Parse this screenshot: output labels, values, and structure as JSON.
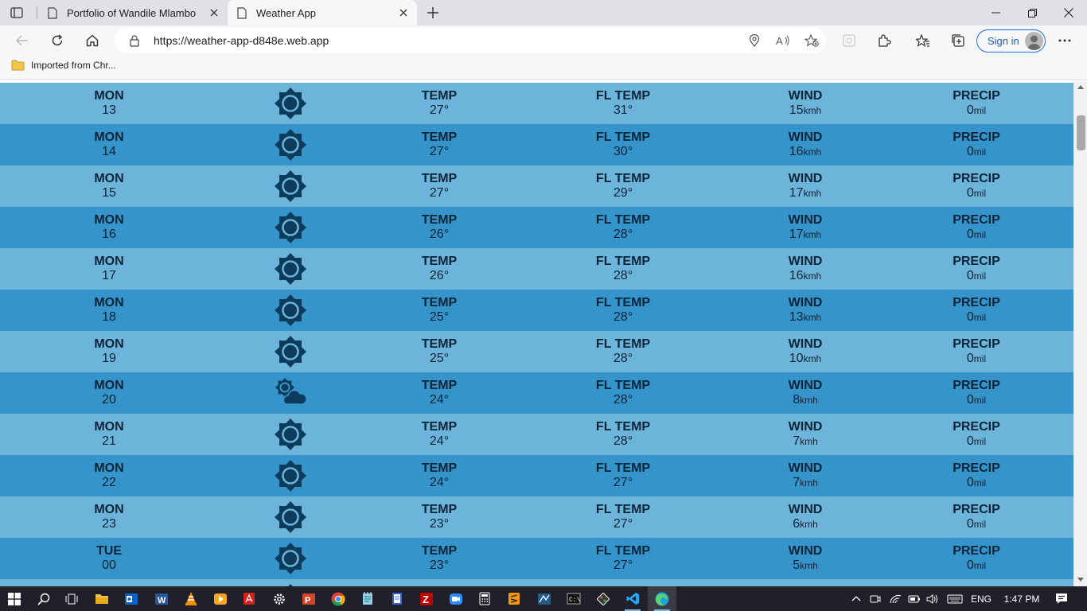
{
  "browser": {
    "tabs": [
      {
        "title": "Portfolio of Wandile Mlambo",
        "active": false
      },
      {
        "title": "Weather App",
        "active": true
      }
    ],
    "url": "https://weather-app-d848e.web.app",
    "signin_label": "Sign in",
    "bookmarks": [
      {
        "label": "Imported from Chr..."
      }
    ]
  },
  "forecast": {
    "labels": {
      "temp": "TEMP",
      "fl_temp": "FL TEMP",
      "wind": "WIND",
      "precip": "PRECIP",
      "wind_unit": "kmh",
      "precip_unit": "mil"
    },
    "rows": [
      {
        "day": "MON",
        "hour": "13",
        "icon": "sun-icon",
        "temp": "27°",
        "fl": "31°",
        "wind": "15",
        "precip": "0"
      },
      {
        "day": "MON",
        "hour": "14",
        "icon": "sun-icon",
        "temp": "27°",
        "fl": "30°",
        "wind": "16",
        "precip": "0"
      },
      {
        "day": "MON",
        "hour": "15",
        "icon": "sun-icon",
        "temp": "27°",
        "fl": "29°",
        "wind": "17",
        "precip": "0"
      },
      {
        "day": "MON",
        "hour": "16",
        "icon": "sun-icon",
        "temp": "26°",
        "fl": "28°",
        "wind": "17",
        "precip": "0"
      },
      {
        "day": "MON",
        "hour": "17",
        "icon": "sun-icon",
        "temp": "26°",
        "fl": "28°",
        "wind": "16",
        "precip": "0"
      },
      {
        "day": "MON",
        "hour": "18",
        "icon": "sun-icon",
        "temp": "25°",
        "fl": "28°",
        "wind": "13",
        "precip": "0"
      },
      {
        "day": "MON",
        "hour": "19",
        "icon": "sun-icon",
        "temp": "25°",
        "fl": "28°",
        "wind": "10",
        "precip": "0"
      },
      {
        "day": "MON",
        "hour": "20",
        "icon": "partly-cloudy-icon",
        "temp": "24°",
        "fl": "28°",
        "wind": "8",
        "precip": "0"
      },
      {
        "day": "MON",
        "hour": "21",
        "icon": "sun-icon",
        "temp": "24°",
        "fl": "28°",
        "wind": "7",
        "precip": "0"
      },
      {
        "day": "MON",
        "hour": "22",
        "icon": "sun-icon",
        "temp": "24°",
        "fl": "27°",
        "wind": "7",
        "precip": "0"
      },
      {
        "day": "MON",
        "hour": "23",
        "icon": "sun-icon",
        "temp": "23°",
        "fl": "27°",
        "wind": "6",
        "precip": "0"
      },
      {
        "day": "TUE",
        "hour": "00",
        "icon": "sun-icon",
        "temp": "23°",
        "fl": "27°",
        "wind": "5",
        "precip": "0"
      },
      {
        "day": "",
        "hour": "",
        "icon": "sun-icon",
        "temp": "",
        "fl": "",
        "wind": "",
        "precip": ""
      }
    ],
    "colors": {
      "row_light": "#6cb4d9",
      "row_dark": "#3595cb",
      "icon": "#0d3b5c",
      "text": "#0d2338"
    }
  },
  "taskbar": {
    "apps": [
      "start-icon",
      "search-icon",
      "task-view-icon",
      "file-explorer-icon",
      "outlook-icon",
      "word-icon",
      "vlc-icon",
      "media-player-icon",
      "acrobat-icon",
      "settings-icon",
      "powerpoint-icon",
      "chrome-icon",
      "notepad-icon",
      "notes-icon",
      "filezilla-icon",
      "zoom-icon",
      "calculator-icon",
      "sublime-icon",
      "network-tool-icon",
      "terminal-icon",
      "git-icon",
      "vscode-icon",
      "edge-icon"
    ],
    "language": "ENG",
    "time": "1:47 PM"
  }
}
